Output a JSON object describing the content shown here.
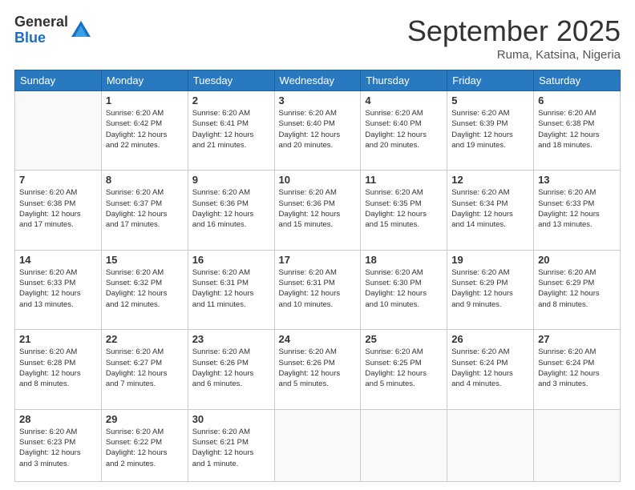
{
  "logo": {
    "general": "General",
    "blue": "Blue"
  },
  "title": "September 2025",
  "location": "Ruma, Katsina, Nigeria",
  "days_header": [
    "Sunday",
    "Monday",
    "Tuesday",
    "Wednesday",
    "Thursday",
    "Friday",
    "Saturday"
  ],
  "weeks": [
    [
      {
        "num": "",
        "info": ""
      },
      {
        "num": "1",
        "info": "Sunrise: 6:20 AM\nSunset: 6:42 PM\nDaylight: 12 hours\nand 22 minutes."
      },
      {
        "num": "2",
        "info": "Sunrise: 6:20 AM\nSunset: 6:41 PM\nDaylight: 12 hours\nand 21 minutes."
      },
      {
        "num": "3",
        "info": "Sunrise: 6:20 AM\nSunset: 6:40 PM\nDaylight: 12 hours\nand 20 minutes."
      },
      {
        "num": "4",
        "info": "Sunrise: 6:20 AM\nSunset: 6:40 PM\nDaylight: 12 hours\nand 20 minutes."
      },
      {
        "num": "5",
        "info": "Sunrise: 6:20 AM\nSunset: 6:39 PM\nDaylight: 12 hours\nand 19 minutes."
      },
      {
        "num": "6",
        "info": "Sunrise: 6:20 AM\nSunset: 6:38 PM\nDaylight: 12 hours\nand 18 minutes."
      }
    ],
    [
      {
        "num": "7",
        "info": "Sunrise: 6:20 AM\nSunset: 6:38 PM\nDaylight: 12 hours\nand 17 minutes."
      },
      {
        "num": "8",
        "info": "Sunrise: 6:20 AM\nSunset: 6:37 PM\nDaylight: 12 hours\nand 17 minutes."
      },
      {
        "num": "9",
        "info": "Sunrise: 6:20 AM\nSunset: 6:36 PM\nDaylight: 12 hours\nand 16 minutes."
      },
      {
        "num": "10",
        "info": "Sunrise: 6:20 AM\nSunset: 6:36 PM\nDaylight: 12 hours\nand 15 minutes."
      },
      {
        "num": "11",
        "info": "Sunrise: 6:20 AM\nSunset: 6:35 PM\nDaylight: 12 hours\nand 15 minutes."
      },
      {
        "num": "12",
        "info": "Sunrise: 6:20 AM\nSunset: 6:34 PM\nDaylight: 12 hours\nand 14 minutes."
      },
      {
        "num": "13",
        "info": "Sunrise: 6:20 AM\nSunset: 6:33 PM\nDaylight: 12 hours\nand 13 minutes."
      }
    ],
    [
      {
        "num": "14",
        "info": "Sunrise: 6:20 AM\nSunset: 6:33 PM\nDaylight: 12 hours\nand 13 minutes."
      },
      {
        "num": "15",
        "info": "Sunrise: 6:20 AM\nSunset: 6:32 PM\nDaylight: 12 hours\nand 12 minutes."
      },
      {
        "num": "16",
        "info": "Sunrise: 6:20 AM\nSunset: 6:31 PM\nDaylight: 12 hours\nand 11 minutes."
      },
      {
        "num": "17",
        "info": "Sunrise: 6:20 AM\nSunset: 6:31 PM\nDaylight: 12 hours\nand 10 minutes."
      },
      {
        "num": "18",
        "info": "Sunrise: 6:20 AM\nSunset: 6:30 PM\nDaylight: 12 hours\nand 10 minutes."
      },
      {
        "num": "19",
        "info": "Sunrise: 6:20 AM\nSunset: 6:29 PM\nDaylight: 12 hours\nand 9 minutes."
      },
      {
        "num": "20",
        "info": "Sunrise: 6:20 AM\nSunset: 6:29 PM\nDaylight: 12 hours\nand 8 minutes."
      }
    ],
    [
      {
        "num": "21",
        "info": "Sunrise: 6:20 AM\nSunset: 6:28 PM\nDaylight: 12 hours\nand 8 minutes."
      },
      {
        "num": "22",
        "info": "Sunrise: 6:20 AM\nSunset: 6:27 PM\nDaylight: 12 hours\nand 7 minutes."
      },
      {
        "num": "23",
        "info": "Sunrise: 6:20 AM\nSunset: 6:26 PM\nDaylight: 12 hours\nand 6 minutes."
      },
      {
        "num": "24",
        "info": "Sunrise: 6:20 AM\nSunset: 6:26 PM\nDaylight: 12 hours\nand 5 minutes."
      },
      {
        "num": "25",
        "info": "Sunrise: 6:20 AM\nSunset: 6:25 PM\nDaylight: 12 hours\nand 5 minutes."
      },
      {
        "num": "26",
        "info": "Sunrise: 6:20 AM\nSunset: 6:24 PM\nDaylight: 12 hours\nand 4 minutes."
      },
      {
        "num": "27",
        "info": "Sunrise: 6:20 AM\nSunset: 6:24 PM\nDaylight: 12 hours\nand 3 minutes."
      }
    ],
    [
      {
        "num": "28",
        "info": "Sunrise: 6:20 AM\nSunset: 6:23 PM\nDaylight: 12 hours\nand 3 minutes."
      },
      {
        "num": "29",
        "info": "Sunrise: 6:20 AM\nSunset: 6:22 PM\nDaylight: 12 hours\nand 2 minutes."
      },
      {
        "num": "30",
        "info": "Sunrise: 6:20 AM\nSunset: 6:21 PM\nDaylight: 12 hours\nand 1 minute."
      },
      {
        "num": "",
        "info": ""
      },
      {
        "num": "",
        "info": ""
      },
      {
        "num": "",
        "info": ""
      },
      {
        "num": "",
        "info": ""
      }
    ]
  ]
}
